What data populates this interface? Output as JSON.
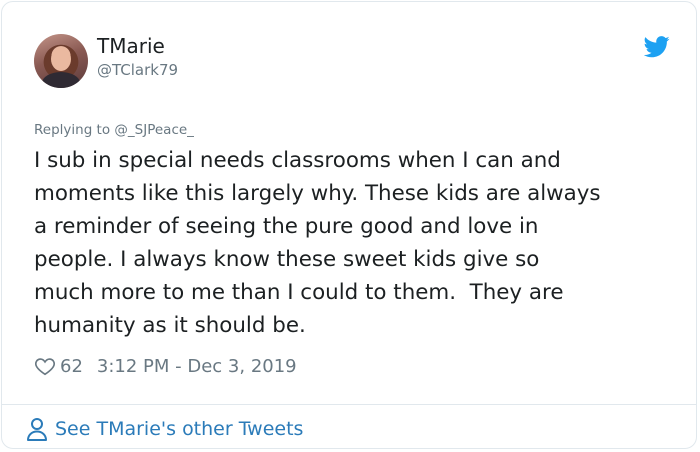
{
  "author": {
    "name": "TMarie",
    "handle": "@TClark79"
  },
  "replying_to": "Replying to @_SJPeace_",
  "tweet": {
    "text": "I sub in special needs classrooms when I can and\nmoments like this largely why. These kids are always\na reminder of seeing the pure good and love in\npeople. I always know these sweet kids give so\nmuch more to me than I could to them.  They are\nhumanity as it should be."
  },
  "meta": {
    "likes": "62",
    "timestamp": "3:12 PM - Dec 3, 2019"
  },
  "footer": {
    "link_label": "See TMarie's other Tweets"
  },
  "icons": {
    "brand": "twitter-bird-icon",
    "like": "heart-icon",
    "profile": "person-icon"
  },
  "colors": {
    "twitter_blue": "#1da1f2",
    "link_blue": "#2b7bb9",
    "secondary_text": "#697882",
    "border": "#e1e8ed"
  }
}
